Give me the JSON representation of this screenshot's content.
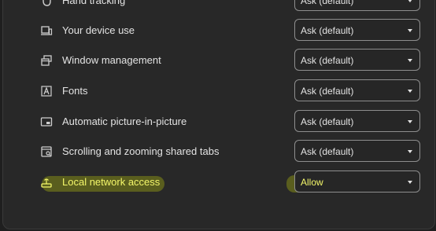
{
  "permissions": [
    {
      "label": "Hand tracking",
      "value": "Ask (default)",
      "icon": "hand-tracking-icon"
    },
    {
      "label": "Your device use",
      "value": "Ask (default)",
      "icon": "device-use-icon"
    },
    {
      "label": "Window management",
      "value": "Ask (default)",
      "icon": "window-management-icon"
    },
    {
      "label": "Fonts",
      "value": "Ask (default)",
      "icon": "fonts-icon"
    },
    {
      "label": "Automatic picture-in-picture",
      "value": "Ask (default)",
      "icon": "picture-in-picture-icon"
    },
    {
      "label": "Scrolling and zooming shared tabs",
      "value": "Ask (default)",
      "icon": "shared-tabs-icon"
    },
    {
      "label": "Local network access",
      "value": "Allow",
      "icon": "local-network-icon"
    }
  ],
  "colors": {
    "background": "#1f1f1f",
    "panel": "#282828",
    "highlight": "#eeff00"
  }
}
